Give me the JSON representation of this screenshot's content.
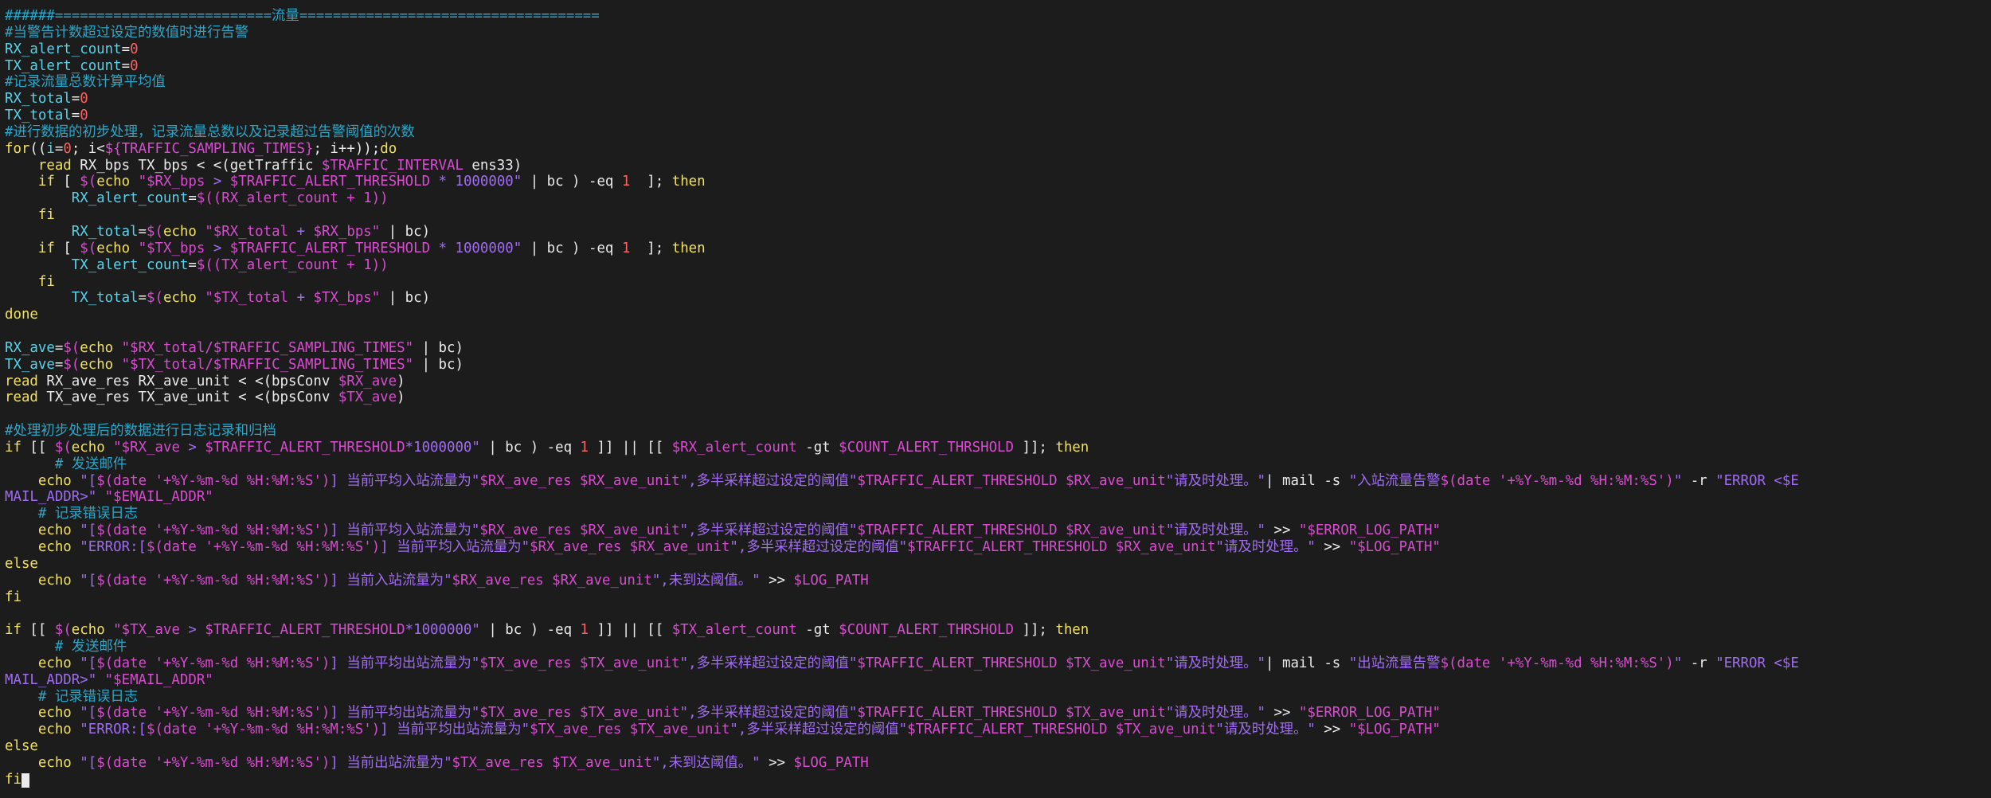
{
  "palette": {
    "background": "#1c1c1c",
    "c": "#2aa6c8",
    "v": "#58d2e8",
    "n": "#ff5f5f",
    "k": "#f2e25a",
    "s": "#d84cd0",
    "w": "#ebebeb",
    "e": "#a06cf0",
    "g": "#f08cf0"
  },
  "lines": [
    [
      [
        "c",
        "######==========================流量===================================="
      ]
    ],
    [
      [
        "c",
        "#当警告计数超过设定的数值时进行告警"
      ]
    ],
    [
      [
        "v",
        "RX_alert_count"
      ],
      [
        "w",
        "="
      ],
      [
        "n",
        "0"
      ]
    ],
    [
      [
        "v",
        "TX_alert_count"
      ],
      [
        "w",
        "="
      ],
      [
        "n",
        "0"
      ]
    ],
    [
      [
        "c",
        "#记录流量总数计算平均值"
      ]
    ],
    [
      [
        "v",
        "RX_total"
      ],
      [
        "w",
        "="
      ],
      [
        "n",
        "0"
      ]
    ],
    [
      [
        "v",
        "TX_total"
      ],
      [
        "w",
        "="
      ],
      [
        "n",
        "0"
      ]
    ],
    [
      [
        "c",
        "#进行数据的初步处理，记录流量总数以及记录超过告警阈值的次数"
      ]
    ],
    [
      [
        "k",
        "for"
      ],
      [
        "w",
        "(("
      ],
      [
        "v",
        "i"
      ],
      [
        "w",
        "="
      ],
      [
        "n",
        "0"
      ],
      [
        "w",
        "; i<"
      ],
      [
        "s",
        "${TRAFFIC_SAMPLING_TIMES}"
      ],
      [
        "w",
        "; i++));"
      ],
      [
        "k",
        "do"
      ]
    ],
    [
      [
        "w",
        "    "
      ],
      [
        "k",
        "read"
      ],
      [
        "w",
        " RX_bps TX_bps < <(getTraffic "
      ],
      [
        "s",
        "$TRAFFIC_INTERVAL"
      ],
      [
        "w",
        " ens33)"
      ]
    ],
    [
      [
        "w",
        "    "
      ],
      [
        "k",
        "if"
      ],
      [
        "w",
        " [ "
      ],
      [
        "s",
        "$("
      ],
      [
        "k",
        "echo"
      ],
      [
        "w",
        " "
      ],
      [
        "s",
        "\"$RX_bps"
      ],
      [
        "e",
        " > "
      ],
      [
        "s",
        "$TRAFFIC_ALERT_THRESHOLD"
      ],
      [
        "e",
        " * 1000000\""
      ],
      [
        "w",
        " | bc ) -eq "
      ],
      [
        "n",
        "1"
      ],
      [
        "w",
        "  ]; "
      ],
      [
        "k",
        "then"
      ]
    ],
    [
      [
        "w",
        "        "
      ],
      [
        "v",
        "RX_alert_count"
      ],
      [
        "w",
        "="
      ],
      [
        "s",
        "$((RX_alert_count + 1))"
      ]
    ],
    [
      [
        "w",
        "    "
      ],
      [
        "k",
        "fi"
      ]
    ],
    [
      [
        "w",
        "        "
      ],
      [
        "v",
        "RX_total"
      ],
      [
        "w",
        "="
      ],
      [
        "s",
        "$("
      ],
      [
        "k",
        "echo"
      ],
      [
        "w",
        " "
      ],
      [
        "s",
        "\"$RX_total"
      ],
      [
        "e",
        " + "
      ],
      [
        "s",
        "$RX_bps\""
      ],
      [
        "w",
        " | bc)"
      ]
    ],
    [
      [
        "w",
        "    "
      ],
      [
        "k",
        "if"
      ],
      [
        "w",
        " [ "
      ],
      [
        "s",
        "$("
      ],
      [
        "k",
        "echo"
      ],
      [
        "w",
        " "
      ],
      [
        "s",
        "\"$TX_bps"
      ],
      [
        "e",
        " > "
      ],
      [
        "s",
        "$TRAFFIC_ALERT_THRESHOLD"
      ],
      [
        "e",
        " * 1000000\""
      ],
      [
        "w",
        " | bc ) -eq "
      ],
      [
        "n",
        "1"
      ],
      [
        "w",
        "  ]; "
      ],
      [
        "k",
        "then"
      ]
    ],
    [
      [
        "w",
        "        "
      ],
      [
        "v",
        "TX_alert_count"
      ],
      [
        "w",
        "="
      ],
      [
        "s",
        "$((TX_alert_count + 1))"
      ]
    ],
    [
      [
        "w",
        "    "
      ],
      [
        "k",
        "fi"
      ]
    ],
    [
      [
        "w",
        "        "
      ],
      [
        "v",
        "TX_total"
      ],
      [
        "w",
        "="
      ],
      [
        "s",
        "$("
      ],
      [
        "k",
        "echo"
      ],
      [
        "w",
        " "
      ],
      [
        "s",
        "\"$TX_total"
      ],
      [
        "e",
        " + "
      ],
      [
        "s",
        "$TX_bps\""
      ],
      [
        "w",
        " | bc)"
      ]
    ],
    [
      [
        "k",
        "done"
      ]
    ],
    [],
    [
      [
        "v",
        "RX_ave"
      ],
      [
        "w",
        "="
      ],
      [
        "s",
        "$("
      ],
      [
        "k",
        "echo"
      ],
      [
        "w",
        " "
      ],
      [
        "s",
        "\"$RX_total/$TRAFFIC_SAMPLING_TIMES\""
      ],
      [
        "w",
        " | bc)"
      ]
    ],
    [
      [
        "v",
        "TX_ave"
      ],
      [
        "w",
        "="
      ],
      [
        "s",
        "$("
      ],
      [
        "k",
        "echo"
      ],
      [
        "w",
        " "
      ],
      [
        "s",
        "\"$TX_total/$TRAFFIC_SAMPLING_TIMES\""
      ],
      [
        "w",
        " | bc)"
      ]
    ],
    [
      [
        "k",
        "read"
      ],
      [
        "w",
        " RX_ave_res RX_ave_unit < <(bpsConv "
      ],
      [
        "s",
        "$RX_ave"
      ],
      [
        "w",
        ")"
      ]
    ],
    [
      [
        "k",
        "read"
      ],
      [
        "w",
        " TX_ave_res TX_ave_unit < <(bpsConv "
      ],
      [
        "s",
        "$TX_ave"
      ],
      [
        "w",
        ")"
      ]
    ],
    [],
    [
      [
        "c",
        "#处理初步处理后的数据进行日志记录和归档"
      ]
    ],
    [
      [
        "k",
        "if"
      ],
      [
        "w",
        " [[ "
      ],
      [
        "s",
        "$("
      ],
      [
        "k",
        "echo"
      ],
      [
        "w",
        " "
      ],
      [
        "s",
        "\"$RX_ave"
      ],
      [
        "e",
        " > "
      ],
      [
        "s",
        "$TRAFFIC_ALERT_THRESHOLD"
      ],
      [
        "e",
        "*1000000\""
      ],
      [
        "w",
        " | bc ) -eq "
      ],
      [
        "n",
        "1"
      ],
      [
        "w",
        " ]] || [[ "
      ],
      [
        "s",
        "$RX_alert_count"
      ],
      [
        "w",
        " -gt "
      ],
      [
        "s",
        "$COUNT_ALERT_THRSHOLD"
      ],
      [
        "w",
        " ]]; "
      ],
      [
        "k",
        "then"
      ]
    ],
    [
      [
        "c",
        "      # 发送邮件"
      ]
    ],
    [
      [
        "w",
        "    "
      ],
      [
        "k",
        "echo"
      ],
      [
        "w",
        " "
      ],
      [
        "e",
        "\"["
      ],
      [
        "s",
        "$(date '+%Y-%m-%d %H:%M:%S')"
      ],
      [
        "e",
        "] 当前平均入站流量为\""
      ],
      [
        "s",
        "$RX_ave_res $RX_ave_unit"
      ],
      [
        "e",
        "\",多半采样超过设定的阈值\""
      ],
      [
        "s",
        "$TRAFFIC_ALERT_THRESHOLD $RX_ave_unit"
      ],
      [
        "e",
        "\"请及时处理。\""
      ],
      [
        "w",
        "| mail -s "
      ],
      [
        "e",
        "\"入站流量告警"
      ],
      [
        "s",
        "$(date '+%Y-%m-%d %H:%M:%S')"
      ],
      [
        "e",
        "\""
      ],
      [
        "w",
        " -r "
      ],
      [
        "e",
        "\"ERROR <$E"
      ]
    ],
    [
      [
        "e",
        "MAIL_ADDR>\""
      ],
      [
        "w",
        " "
      ],
      [
        "s",
        "\"$EMAIL_ADDR\""
      ]
    ],
    [
      [
        "c",
        "    # 记录错误日志"
      ]
    ],
    [
      [
        "w",
        "    "
      ],
      [
        "k",
        "echo"
      ],
      [
        "w",
        " "
      ],
      [
        "e",
        "\"["
      ],
      [
        "s",
        "$(date '+%Y-%m-%d %H:%M:%S')"
      ],
      [
        "e",
        "] 当前平均入站流量为\""
      ],
      [
        "s",
        "$RX_ave_res $RX_ave_unit"
      ],
      [
        "e",
        "\",多半采样超过设定的阈值\""
      ],
      [
        "s",
        "$TRAFFIC_ALERT_THRESHOLD $RX_ave_unit"
      ],
      [
        "e",
        "\"请及时处理。\""
      ],
      [
        "w",
        " >> "
      ],
      [
        "s",
        "\"$ERROR_LOG_PATH\""
      ]
    ],
    [
      [
        "w",
        "    "
      ],
      [
        "k",
        "echo"
      ],
      [
        "w",
        " "
      ],
      [
        "e",
        "\"ERROR:["
      ],
      [
        "s",
        "$(date '+%Y-%m-%d %H:%M:%S')"
      ],
      [
        "e",
        "] 当前平均入站流量为\""
      ],
      [
        "s",
        "$RX_ave_res $RX_ave_unit"
      ],
      [
        "e",
        "\",多半采样超过设定的阈值\""
      ],
      [
        "s",
        "$TRAFFIC_ALERT_THRESHOLD $RX_ave_unit"
      ],
      [
        "e",
        "\"请及时处理。\""
      ],
      [
        "w",
        " >> "
      ],
      [
        "s",
        "\"$LOG_PATH\""
      ]
    ],
    [
      [
        "k",
        "else"
      ]
    ],
    [
      [
        "w",
        "    "
      ],
      [
        "k",
        "echo"
      ],
      [
        "w",
        " "
      ],
      [
        "e",
        "\"["
      ],
      [
        "s",
        "$(date '+%Y-%m-%d %H:%M:%S')"
      ],
      [
        "e",
        "] 当前入站流量为\""
      ],
      [
        "s",
        "$RX_ave_res $RX_ave_unit"
      ],
      [
        "e",
        "\",未到达阈值。\""
      ],
      [
        "w",
        " >> "
      ],
      [
        "s",
        "$LOG_PATH"
      ]
    ],
    [
      [
        "k",
        "fi"
      ]
    ],
    [],
    [
      [
        "k",
        "if"
      ],
      [
        "w",
        " [[ "
      ],
      [
        "s",
        "$("
      ],
      [
        "k",
        "echo"
      ],
      [
        "w",
        " "
      ],
      [
        "s",
        "\"$TX_ave"
      ],
      [
        "e",
        " > "
      ],
      [
        "s",
        "$TRAFFIC_ALERT_THRESHOLD"
      ],
      [
        "e",
        "*1000000\""
      ],
      [
        "w",
        " | bc ) -eq "
      ],
      [
        "n",
        "1"
      ],
      [
        "w",
        " ]] || [[ "
      ],
      [
        "s",
        "$TX_alert_count"
      ],
      [
        "w",
        " -gt "
      ],
      [
        "s",
        "$COUNT_ALERT_THRSHOLD"
      ],
      [
        "w",
        " ]]; "
      ],
      [
        "k",
        "then"
      ]
    ],
    [
      [
        "c",
        "      # 发送邮件"
      ]
    ],
    [
      [
        "w",
        "    "
      ],
      [
        "k",
        "echo"
      ],
      [
        "w",
        " "
      ],
      [
        "e",
        "\"["
      ],
      [
        "s",
        "$(date '+%Y-%m-%d %H:%M:%S')"
      ],
      [
        "e",
        "] 当前平均出站流量为\""
      ],
      [
        "s",
        "$TX_ave_res $TX_ave_unit"
      ],
      [
        "e",
        "\",多半采样超过设定的阈值\""
      ],
      [
        "s",
        "$TRAFFIC_ALERT_THRESHOLD $TX_ave_unit"
      ],
      [
        "e",
        "\"请及时处理。\""
      ],
      [
        "w",
        "| mail -s "
      ],
      [
        "e",
        "\"出站流量告警"
      ],
      [
        "s",
        "$(date '+%Y-%m-%d %H:%M:%S')"
      ],
      [
        "e",
        "\""
      ],
      [
        "w",
        " -r "
      ],
      [
        "e",
        "\"ERROR <$E"
      ]
    ],
    [
      [
        "e",
        "MAIL_ADDR>\""
      ],
      [
        "w",
        " "
      ],
      [
        "s",
        "\"$EMAIL_ADDR\""
      ]
    ],
    [
      [
        "c",
        "    # 记录错误日志"
      ]
    ],
    [
      [
        "w",
        "    "
      ],
      [
        "k",
        "echo"
      ],
      [
        "w",
        " "
      ],
      [
        "e",
        "\"["
      ],
      [
        "s",
        "$(date '+%Y-%m-%d %H:%M:%S')"
      ],
      [
        "e",
        "] 当前平均出站流量为\""
      ],
      [
        "s",
        "$TX_ave_res $TX_ave_unit"
      ],
      [
        "e",
        "\",多半采样超过设定的阈值\""
      ],
      [
        "s",
        "$TRAFFIC_ALERT_THRESHOLD $TX_ave_unit"
      ],
      [
        "e",
        "\"请及时处理。\""
      ],
      [
        "w",
        " >> "
      ],
      [
        "s",
        "\"$ERROR_LOG_PATH\""
      ]
    ],
    [
      [
        "w",
        "    "
      ],
      [
        "k",
        "echo"
      ],
      [
        "w",
        " "
      ],
      [
        "e",
        "\"ERROR:["
      ],
      [
        "s",
        "$(date '+%Y-%m-%d %H:%M:%S')"
      ],
      [
        "e",
        "] 当前平均出站流量为\""
      ],
      [
        "s",
        "$TX_ave_res $TX_ave_unit"
      ],
      [
        "e",
        "\",多半采样超过设定的阈值\""
      ],
      [
        "s",
        "$TRAFFIC_ALERT_THRESHOLD $TX_ave_unit"
      ],
      [
        "e",
        "\"请及时处理。\""
      ],
      [
        "w",
        " >> "
      ],
      [
        "s",
        "\"$LOG_PATH\""
      ]
    ],
    [
      [
        "k",
        "else"
      ]
    ],
    [
      [
        "w",
        "    "
      ],
      [
        "k",
        "echo"
      ],
      [
        "w",
        " "
      ],
      [
        "e",
        "\"["
      ],
      [
        "s",
        "$(date '+%Y-%m-%d %H:%M:%S')"
      ],
      [
        "e",
        "] 当前出站流量为\""
      ],
      [
        "s",
        "$TX_ave_res $TX_ave_unit"
      ],
      [
        "e",
        "\",未到达阈值。\""
      ],
      [
        "w",
        " >> "
      ],
      [
        "s",
        "$LOG_PATH"
      ]
    ],
    [
      [
        "k",
        "fi"
      ]
    ]
  ]
}
